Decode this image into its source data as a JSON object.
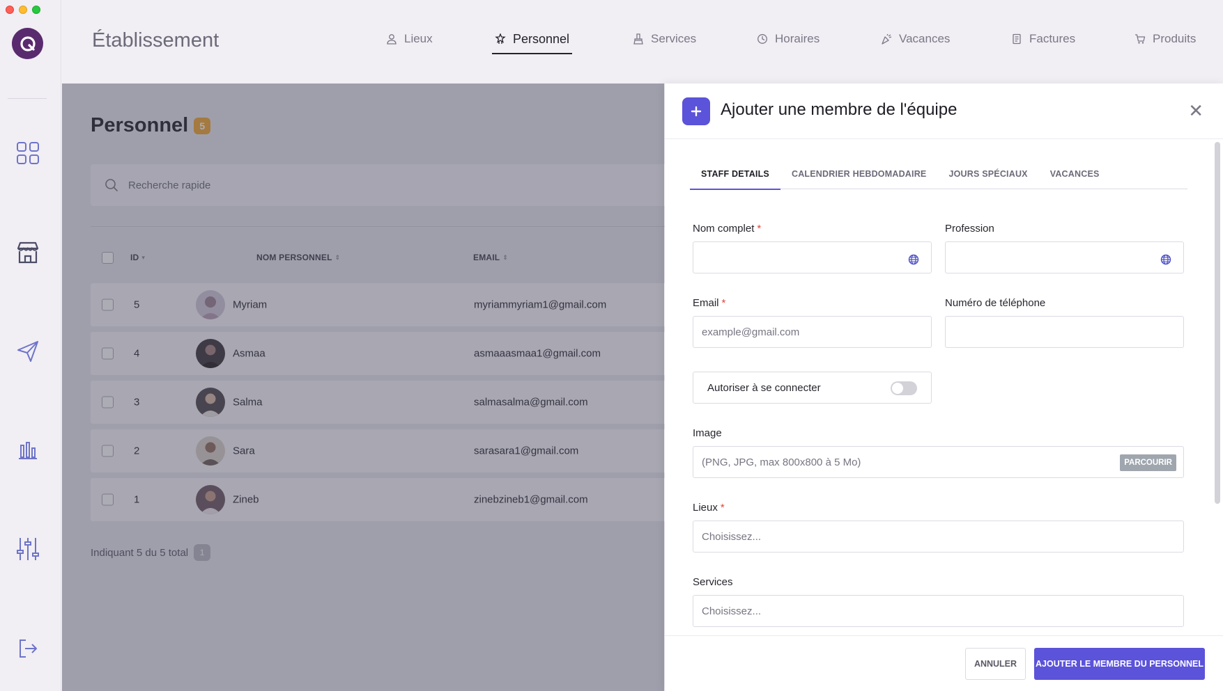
{
  "window": {
    "title": "Établissement"
  },
  "nav": {
    "tabs": [
      {
        "label": "Lieux",
        "icon": "person-pin-icon"
      },
      {
        "label": "Personnel",
        "icon": "staff-star-icon",
        "active": true
      },
      {
        "label": "Services",
        "icon": "brush-icon"
      },
      {
        "label": "Horaires",
        "icon": "clock-icon"
      },
      {
        "label": "Vacances",
        "icon": "party-icon"
      },
      {
        "label": "Factures",
        "icon": "invoice-icon"
      },
      {
        "label": "Produits",
        "icon": "cart-icon"
      }
    ]
  },
  "sidebar": {
    "items": [
      {
        "name": "dashboard-grid-icon"
      },
      {
        "name": "store-icon"
      },
      {
        "name": "send-icon"
      },
      {
        "name": "bar-chart-icon"
      },
      {
        "name": "sliders-icon"
      },
      {
        "name": "logout-icon"
      }
    ]
  },
  "page": {
    "title": "Personnel",
    "count": "5",
    "search_placeholder": "Recherche rapide",
    "columns": {
      "id": "ID",
      "name": "NOM PERSONNEL",
      "email": "EMAIL"
    },
    "rows": [
      {
        "id": "5",
        "name": "Myriam",
        "email": "myriammyriam1@gmail.com"
      },
      {
        "id": "4",
        "name": "Asmaa",
        "email": "asmaaasmaa1@gmail.com"
      },
      {
        "id": "3",
        "name": "Salma",
        "email": "salmasalma@gmail.com"
      },
      {
        "id": "2",
        "name": "Sara",
        "email": "sarasara1@gmail.com"
      },
      {
        "id": "1",
        "name": "Zineb",
        "email": "zinebzineb1@gmail.com"
      }
    ],
    "footer_text": "Indiquant 5 du 5 total",
    "page_number": "1"
  },
  "drawer": {
    "title": "Ajouter une membre de l'équipe",
    "tabs": [
      "STAFF DETAILS",
      "CALENDRIER HEBDOMADAIRE",
      "JOURS SPÉCIAUX",
      "VACANCES"
    ],
    "fields": {
      "full_name_label": "Nom complet",
      "profession_label": "Profession",
      "email_label": "Email",
      "email_placeholder": "example@gmail.com",
      "phone_label": "Numéro de téléphone",
      "allow_login_label": "Autoriser à se connecter",
      "allow_login_value": false,
      "image_label": "Image",
      "image_hint": "(PNG, JPG, max 800x800 à 5 Mo)",
      "browse_label": "PARCOURIR",
      "locations_label": "Lieux",
      "locations_placeholder": "Choisissez...",
      "services_label": "Services",
      "services_placeholder": "Choisissez...",
      "required_mark": "*"
    },
    "cancel_label": "ANNULER",
    "submit_label": "AJOUTER LE MEMBRE DU PERSONNEL"
  },
  "colors": {
    "accent": "#5b53d9",
    "badge": "#f0a52b",
    "brand": "#5a2a6e",
    "required": "#e2453a"
  }
}
